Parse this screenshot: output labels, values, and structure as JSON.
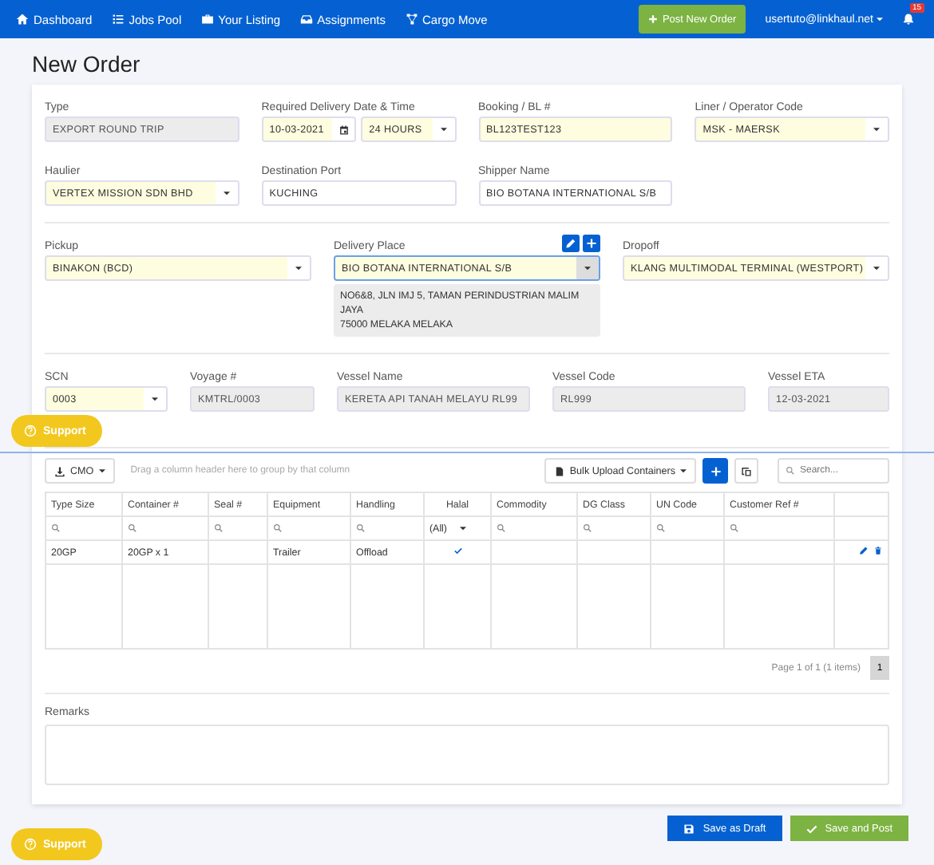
{
  "nav": {
    "items": [
      {
        "label": "Dashboard"
      },
      {
        "label": "Jobs Pool"
      },
      {
        "label": "Your Listing"
      },
      {
        "label": "Assignments"
      },
      {
        "label": "Cargo Move"
      }
    ],
    "post_button": "Post New Order",
    "user": "usertuto@linkhaul.net",
    "notifications": "15"
  },
  "page_title": "New Order",
  "form_rows": [
    [
      {
        "label": "Type",
        "kind": "readonly",
        "value": "EXPORT ROUND TRIP"
      },
      {
        "label": "Required Delivery Date & Time",
        "kind": "datetime",
        "date": "10-03-2021",
        "time": "24 HOURS",
        "highlighted": true
      },
      {
        "label": "Booking / BL #",
        "kind": "text",
        "value": "BL123TEST123",
        "highlighted": true
      },
      {
        "label": "Liner / Operator Code",
        "kind": "select",
        "value": "MSK - MAERSK",
        "highlighted": true
      }
    ],
    [
      {
        "label": "Haulier",
        "kind": "select",
        "value": "VERTEX MISSION SDN BHD",
        "highlighted": true
      },
      {
        "label": "Destination Port",
        "kind": "text",
        "value": "KUCHING",
        "highlighted": false
      },
      {
        "label": "Shipper Name",
        "kind": "text",
        "value": "BIO BOTANA INTERNATIONAL S/B",
        "highlighted": false
      }
    ],
    [
      {
        "label": "Pickup",
        "kind": "select",
        "value": "BINAKON (BCD)",
        "highlighted": true
      },
      {
        "label": "Delivery Place",
        "kind": "select",
        "value": "BIO BOTANA INTERNATIONAL S/B",
        "highlighted": true,
        "focused": true,
        "editable": true,
        "address": [
          "NO6&8, JLN IMJ 5, TAMAN PERINDUSTRIAN MALIM JAYA",
          "75000 MELAKA MELAKA"
        ]
      },
      {
        "label": "Dropoff",
        "kind": "select",
        "value": "KLANG MULTIMODAL TERMINAL (WESTPORT)",
        "highlighted": true
      }
    ],
    [
      {
        "label": "SCN",
        "kind": "select",
        "value": "0003",
        "highlighted": true
      },
      {
        "label": "Voyage #",
        "kind": "readonly",
        "value": "KMTRL/0003"
      },
      {
        "label": "Vessel Name",
        "kind": "readonly",
        "value": "KERETA API TANAH MELAYU RL99"
      },
      {
        "label": "Vessel Code",
        "kind": "readonly",
        "value": "RL999"
      },
      {
        "label": "Vessel ETA",
        "kind": "readonly",
        "value": "12-03-2021"
      }
    ]
  ],
  "grid": {
    "export_button": "CMO",
    "group_hint": "Drag a column header here to group by that column",
    "bulk_button": "Bulk Upload Containers",
    "search": {
      "placeholder": "Search..."
    },
    "columns": [
      {
        "label": "Type Size",
        "kind": "text"
      },
      {
        "label": "Container #",
        "kind": "text"
      },
      {
        "label": "Seal #",
        "kind": "text"
      },
      {
        "label": "Equipment",
        "kind": "text"
      },
      {
        "label": "Handling",
        "kind": "text"
      },
      {
        "label": "Halal",
        "kind": "check",
        "filter": "(All)"
      },
      {
        "label": "Commodity",
        "kind": "text"
      },
      {
        "label": "DG Class",
        "kind": "text"
      },
      {
        "label": "UN Code",
        "kind": "text"
      },
      {
        "label": "Customer Ref #",
        "kind": "text"
      }
    ],
    "rows": [
      {
        "type_size": "20GP",
        "container_no": "20GP x 1",
        "equipment": "Trailer",
        "handling": "Offload",
        "halal": true
      }
    ],
    "pager": "Page 1 of 1 (1 items)",
    "pages": [
      {
        "label": "1",
        "selected": true
      }
    ]
  },
  "remarks": {
    "label": "Remarks"
  },
  "buttons": [
    {
      "label": "Save as Draft",
      "kind": "draft"
    },
    {
      "label": "Save and Post",
      "kind": "post"
    }
  ],
  "support": [
    "Support",
    "Support"
  ]
}
